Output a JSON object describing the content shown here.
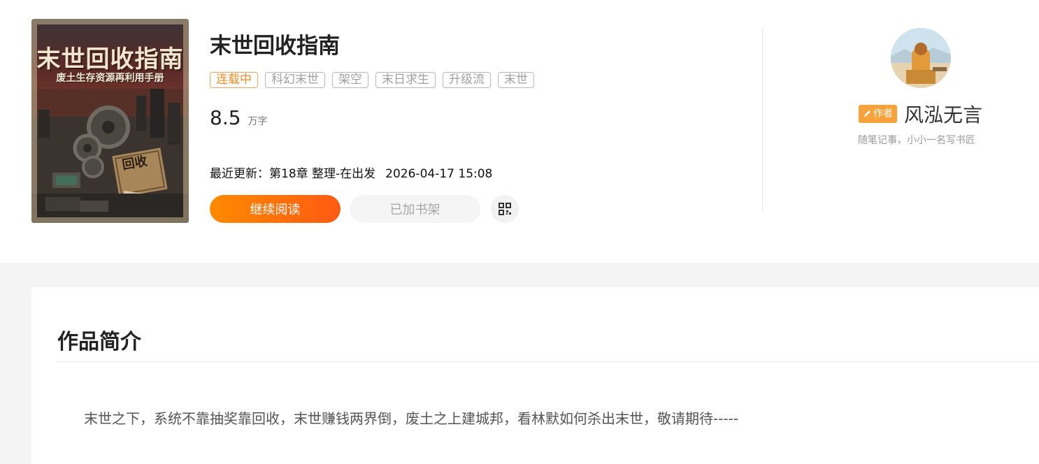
{
  "book": {
    "cover_title": "末世回收指南",
    "cover_subtitle": "废土生存资源再利用手册",
    "cover_stamp": "回收",
    "title": "末世回收指南",
    "status": "连载中",
    "tags": [
      "科幻末世",
      "架空",
      "末日求生",
      "升级流",
      "末世"
    ],
    "word_count": "8.5",
    "word_unit": "万字",
    "latest_label": "最近更新：第18章 整理-在出发",
    "latest_time": "2026-04-17 15:08"
  },
  "actions": {
    "read_label": "继续阅读",
    "shelf_label": "已加书架",
    "qr_icon": "qr-code-icon"
  },
  "author": {
    "badge": "作者",
    "name": "风泓无言",
    "bio": "随笔记事，小小一名写书匠"
  },
  "intro": {
    "heading": "作品简介",
    "text": "末世之下，系统不靠抽奖靠回收，末世赚钱两界倒，废土之上建城邦，看林默如何杀出末世，敬请期待-----"
  },
  "colors": {
    "accent": "#ff6a00",
    "status": "#f08a20",
    "author_badge": "#f7a23b"
  }
}
